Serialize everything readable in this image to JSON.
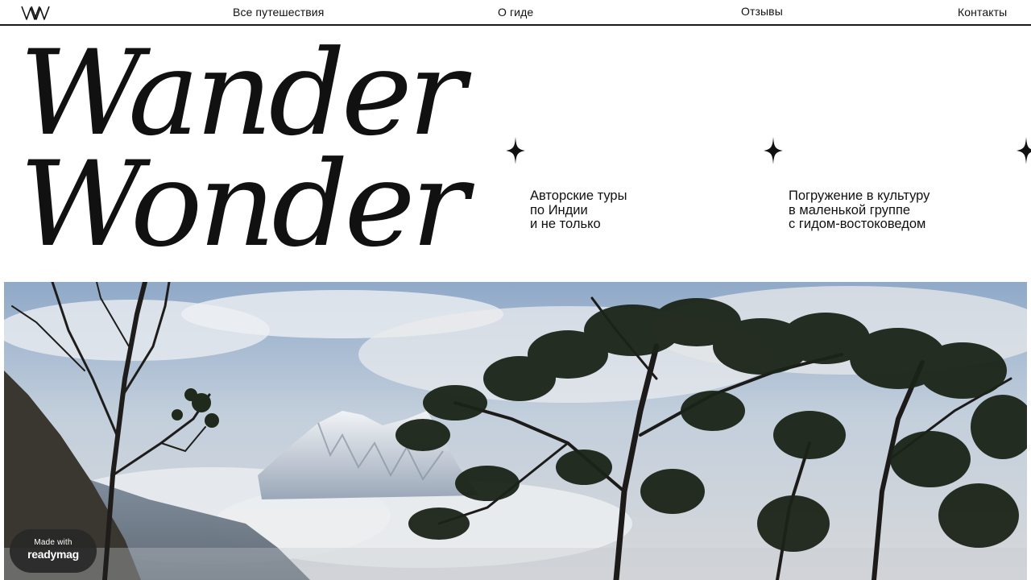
{
  "nav": {
    "logo_alt": "WW",
    "links": [
      {
        "label": "Все путешествия"
      },
      {
        "label": "О гиде"
      },
      {
        "label": "Отзывы"
      },
      {
        "label": "Контакты"
      }
    ]
  },
  "hero": {
    "line1": "Wander",
    "line2": "Wonder"
  },
  "taglines": [
    {
      "lines": [
        "Авторские туры",
        "по Индии",
        "и не только"
      ]
    },
    {
      "lines": [
        "Погружение в культуру",
        "в маленькой группе",
        "с гидом-востоковедом"
      ]
    }
  ],
  "photo": {
    "icon": "landscape-photo"
  },
  "badge": {
    "small": "Made with",
    "brand": "readymag"
  },
  "colors": {
    "text": "#111111",
    "background": "#ffffff",
    "badge_bg": "#282828"
  }
}
